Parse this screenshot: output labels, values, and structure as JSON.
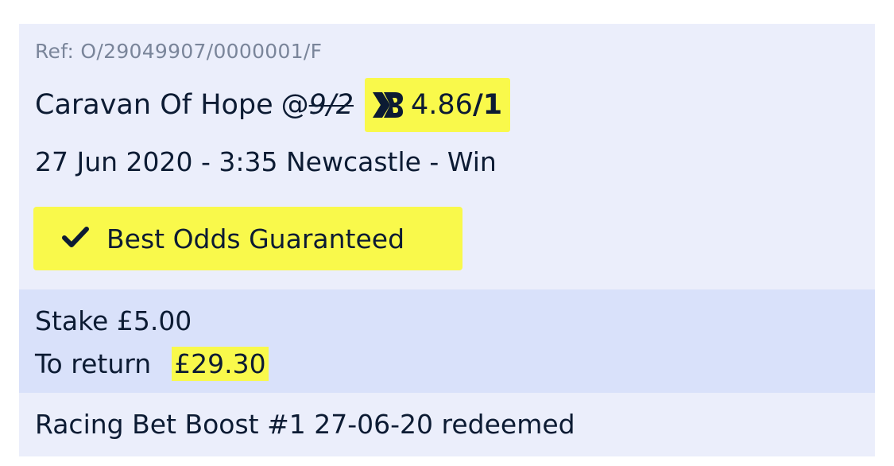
{
  "bet": {
    "ref": "Ref: O/29049907/0000001/F",
    "selection_name": "Caravan Of Hope",
    "at_symbol": "@",
    "original_odds": "9/2",
    "boost_icon": "bet-boost-icon",
    "boosted_odds_num": "4.86",
    "boosted_odds_denom": "/1",
    "event": "27 Jun 2020 - 3:35 Newcastle - Win",
    "bog_icon": "checkmark-icon",
    "bog_label": "Best Odds Guaranteed"
  },
  "stake": {
    "stake_text": "Stake £5.00",
    "return_label": "To return",
    "return_value": "£29.30"
  },
  "boost_note": "Racing Bet Boost #1 27-06-20 redeemed",
  "colors": {
    "card_bg": "#ebeefb",
    "stake_bg": "#d9e1fa",
    "highlight": "#f9f94b",
    "text": "#0c1b33",
    "muted": "#7a859a"
  }
}
